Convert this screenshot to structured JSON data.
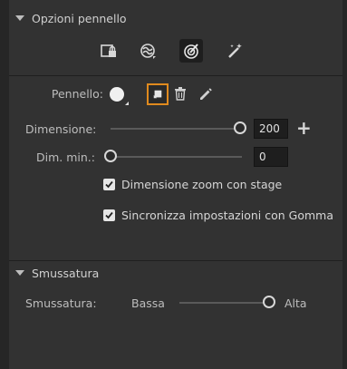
{
  "brush_options": {
    "title": "Opzioni pennello",
    "tools": [
      {
        "icon": "lock-fill-icon",
        "active": false
      },
      {
        "icon": "paint-behind-icon",
        "active": false
      },
      {
        "icon": "paint-inside-icon",
        "active": true
      },
      {
        "icon": "magic-brush-icon",
        "active": false
      }
    ],
    "brush_label": "Pennello:",
    "size_label": "Dimensione:",
    "size_value": "200",
    "size_slider": 1.0,
    "min_size_label": "Dim. min.:",
    "min_size_value": "0",
    "min_size_slider": 0.0,
    "zoom_checkbox_label": "Dimensione zoom con stage",
    "zoom_checked": true,
    "sync_checkbox_label": "Sincronizza impostazioni con Gomma",
    "sync_checked": true
  },
  "smoothing": {
    "title": "Smussatura",
    "label": "Smussatura:",
    "low_label": "Bassa",
    "high_label": "Alta",
    "slider": 1.0
  },
  "colors": {
    "accent": "#e08a1e",
    "panel_bg": "#323232"
  }
}
